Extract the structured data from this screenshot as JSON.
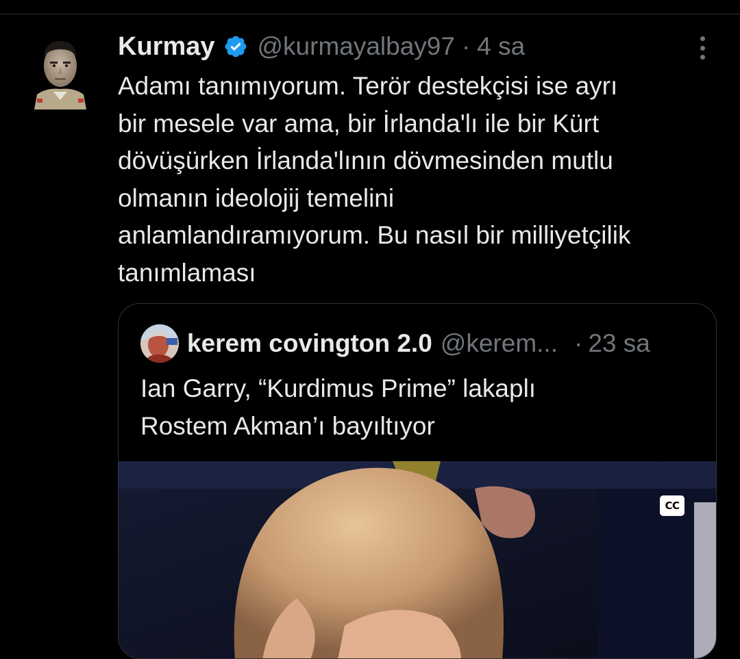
{
  "tweet": {
    "display_name": "Kurmay",
    "handle": "@kurmayalbay97",
    "separator": "·",
    "time": "4 sa",
    "text_lines": [
      "Adamı tanımıyorum. Terör destekçisi ise ayrı",
      "bir mesele var ama, bir İrlanda'lı ile bir Kürt",
      "dövüşürken İrlanda'lının dövmesinden mutlu",
      "olmanın ideolojij temelini",
      "anlamlandıramıyorum. Bu nasıl bir milliyetçilik",
      "tanımlaması"
    ]
  },
  "quote": {
    "display_name": "kerem covington 2.0",
    "handle": "@kerem...",
    "separator": "·",
    "time": "23 sa",
    "text_lines": [
      "Ian Garry, “Kurdimus Prime” lakaplı",
      "Rostem Akman’ı bayıltıyor"
    ],
    "cc_label": "CC"
  },
  "icons": {
    "verified": "verified-badge-icon",
    "more": "more-options-icon"
  },
  "colors": {
    "background": "#000000",
    "text_primary": "#e7e9ea",
    "text_secondary": "#71767b",
    "border": "#2f3336",
    "verified_blue": "#1d9bf0"
  }
}
